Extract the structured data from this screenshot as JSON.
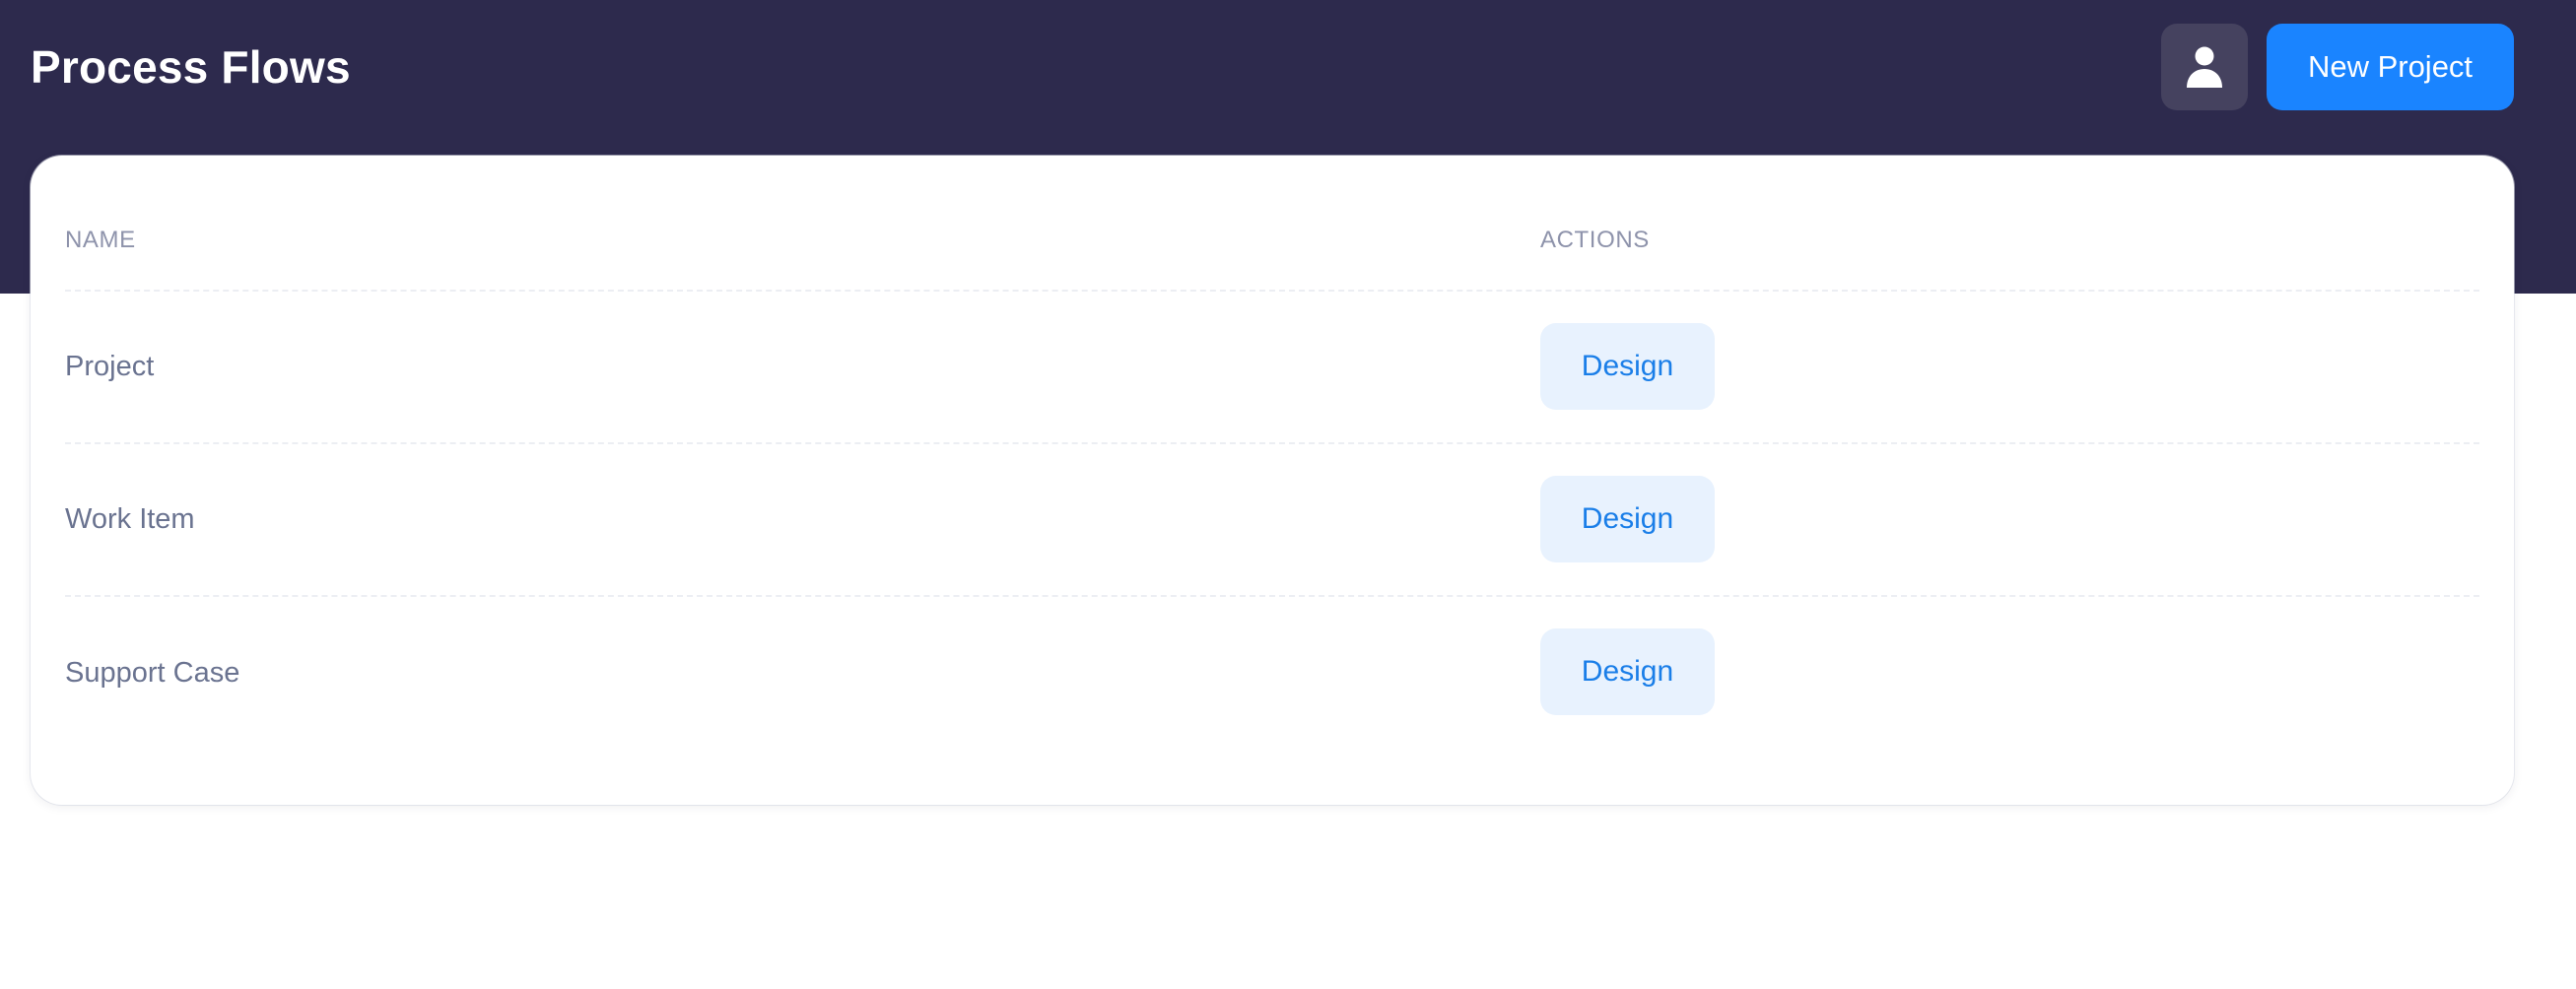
{
  "header": {
    "title": "Process Flows",
    "new_project_label": "New Project",
    "avatar_icon": "user-icon"
  },
  "table": {
    "columns": [
      "NAME",
      "ACTIONS"
    ],
    "rows": [
      {
        "name": "Project",
        "action": "Design"
      },
      {
        "name": "Work Item",
        "action": "Design"
      },
      {
        "name": "Support Case",
        "action": "Design"
      }
    ]
  },
  "colors": {
    "header_bg": "#2d2a4d",
    "primary": "#1a84ff",
    "design_button_bg": "#e8f2fe",
    "design_button_text": "#1a7ee8"
  }
}
